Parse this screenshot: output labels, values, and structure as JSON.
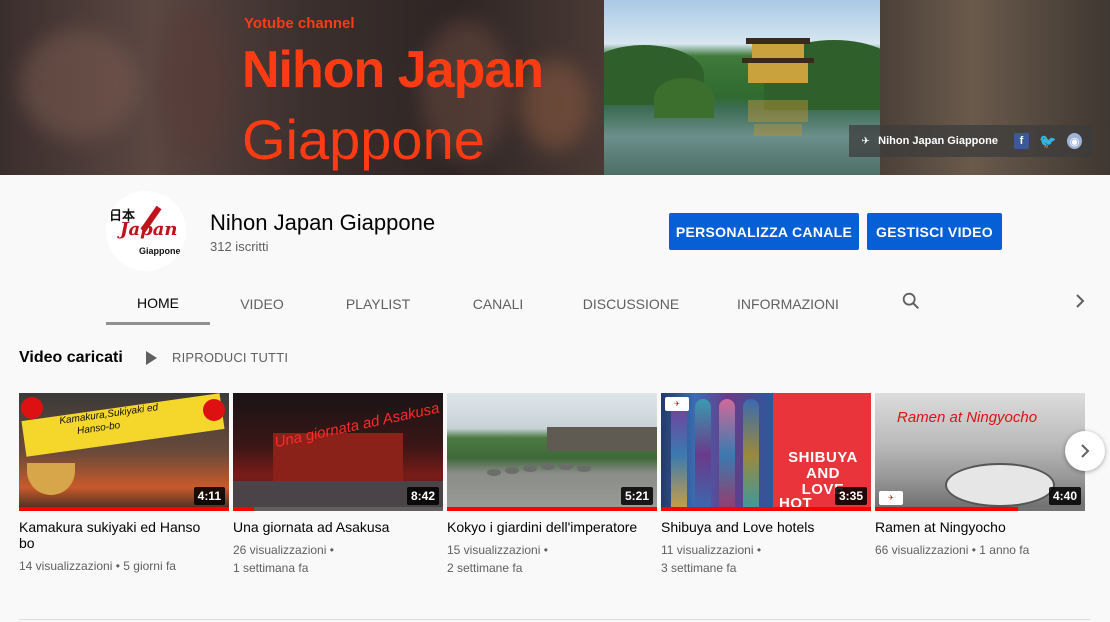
{
  "banner": {
    "subtitle": "Yotube channel",
    "title_line1": "Nihon Japan",
    "title_line2": "Giappone",
    "links": {
      "channel_name": "Nihon Japan Giappone",
      "icons": [
        "facebook-icon",
        "twitter-icon",
        "website-icon"
      ]
    }
  },
  "channel": {
    "name": "Nihon Japan Giappone",
    "subscribers": "312 iscritti",
    "avatar": {
      "kanji": "日本",
      "script": "Japan",
      "caption": "Giappone"
    },
    "buttons": {
      "customize": "PERSONALIZZA CANALE",
      "manage": "GESTISCI VIDEO"
    },
    "tabs": [
      "HOME",
      "VIDEO",
      "PLAYLIST",
      "CANALI",
      "DISCUSSIONE",
      "INFORMAZIONI"
    ],
    "active_tab": "HOME"
  },
  "section": {
    "title": "Video caricati",
    "play_all": "RIPRODUCI TUTTI"
  },
  "videos": [
    {
      "title": "Kamakura sukiyaki ed Hanso bo",
      "duration": "4:11",
      "views": "14 visualizzazioni",
      "age": "5 giorni fa",
      "thumb_text": [
        "Kamakura,Sukiyaki ed",
        "Hanso-bo"
      ],
      "watched_fraction": 1.0
    },
    {
      "title": "Una giornata ad Asakusa",
      "duration": "8:42",
      "views": "26 visualizzazioni",
      "age": "1 settimana fa",
      "thumb_text": [
        "Una giornata ad Asakusa"
      ],
      "watched_fraction": 0.1
    },
    {
      "title": "Kokyo i giardini dell'imperatore",
      "duration": "5:21",
      "views": "15 visualizzazioni",
      "age": "2 settimane fa",
      "thumb_text": [],
      "watched_fraction": 1.0
    },
    {
      "title": "Shibuya and Love hotels",
      "duration": "3:35",
      "views": "11 visualizzazioni",
      "age": "3 settimane fa",
      "thumb_text": [
        "SHIBUYA",
        "AND",
        "LOVE",
        "HOT"
      ],
      "watched_fraction": 1.0
    },
    {
      "title": "Ramen at Ningyocho",
      "duration": "4:40",
      "views": "66 visualizzazioni",
      "age": "1 anno fa",
      "thumb_text": [
        "Ramen at Ningyocho"
      ],
      "watched_fraction": 0.68
    }
  ],
  "colors": {
    "primary_button": "#065fd4",
    "banner_text": "#ff3b14",
    "progress": "#ff0000"
  }
}
